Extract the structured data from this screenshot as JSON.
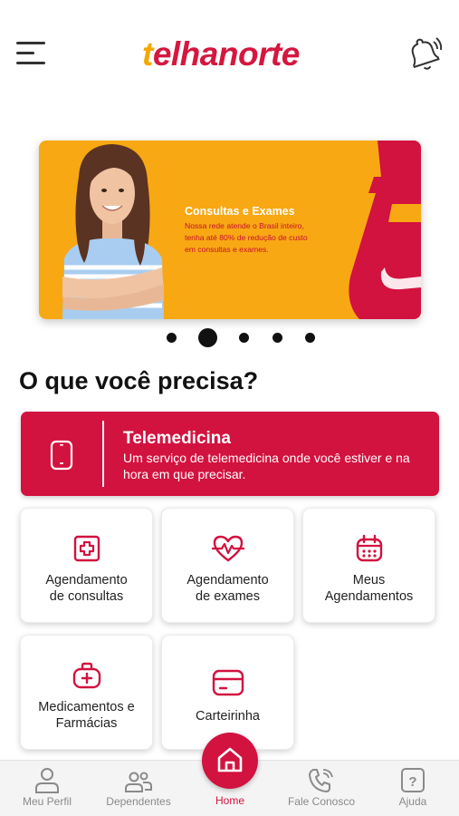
{
  "header": {
    "logo_mark": "t",
    "logo_rest": "elhanorte",
    "menu_icon": "hamburger-menu-icon",
    "notification_icon": "bell-ringing-icon"
  },
  "banner": {
    "title": "Consultas e Exames",
    "subtitle_line1": "Nossa rede atende o Brasil inteiro,",
    "subtitle_line2": "tenha até 80% de redução de custo",
    "subtitle_line3": "em consultas e exames.",
    "slide_count": 5,
    "active_slide": 2
  },
  "section": {
    "title": "O que você precisa?"
  },
  "telemedicine": {
    "title": "Telemedicina",
    "description": "Um serviço de telemedicina onde você estiver e na hora em que precisar.",
    "icon": "smartphone-icon"
  },
  "services": [
    {
      "label_line1": "Agendamento",
      "label_line2": "de consultas",
      "icon": "medical-cross-icon"
    },
    {
      "label_line1": "Agendamento",
      "label_line2": "de exames",
      "icon": "heartbeat-icon"
    },
    {
      "label_line1": "Meus",
      "label_line2": "Agendamentos",
      "icon": "calendar-icon"
    },
    {
      "label_line1": "Medicamentos e",
      "label_line2": "Farmácias",
      "icon": "medical-bag-icon"
    },
    {
      "label_line1": "Carteirinha",
      "label_line2": "",
      "icon": "card-icon"
    }
  ],
  "bottom_nav": {
    "items": [
      {
        "label": "Meu Perfil",
        "icon": "user-icon"
      },
      {
        "label": "Dependentes",
        "icon": "users-icon"
      },
      {
        "label": "Home",
        "icon": "home-icon"
      },
      {
        "label": "Fale Conosco",
        "icon": "phone-icon"
      },
      {
        "label": "Ajuda",
        "icon": "help-icon"
      }
    ],
    "active": "Home"
  },
  "colors": {
    "brand_red": "#d2123f",
    "brand_yellow": "#f5a800",
    "banner_orange": "#f8a813"
  }
}
